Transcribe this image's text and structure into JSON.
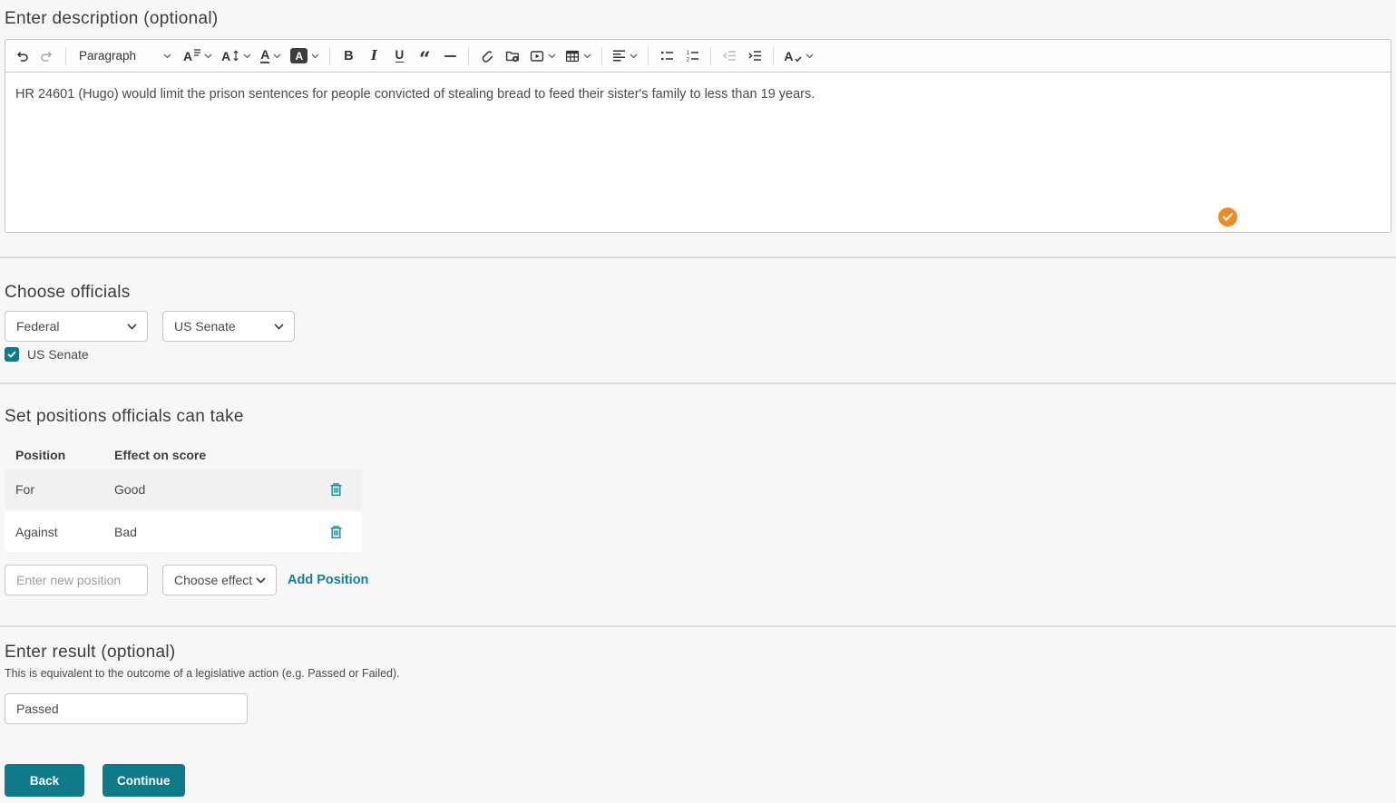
{
  "description_section": {
    "heading": "Enter description (optional)",
    "editor": {
      "block_format": "Paragraph",
      "content": "HR 24601 (Hugo) would limit the prison sentences for people convicted of stealing bread to feed their sister's family to less than 19 years.",
      "toolbar_buttons": [
        "undo",
        "redo",
        "paragraph-format",
        "font-family",
        "font-size",
        "font-color",
        "font-background-color",
        "bold",
        "italic",
        "underline",
        "block-quote",
        "horizontal-line",
        "link",
        "insert-file",
        "insert-media",
        "insert-table",
        "text-alignment",
        "bulleted-list",
        "numbered-list",
        "decrease-indent",
        "increase-indent",
        "text-style"
      ],
      "status_icon": "orange-check-badge"
    }
  },
  "officials_section": {
    "heading": "Choose officials",
    "jurisdiction_select_value": "Federal",
    "body_select_value": "US Senate",
    "checkbox": {
      "label": "US Senate",
      "checked": true
    }
  },
  "positions_section": {
    "heading": "Set positions officials can take",
    "table": {
      "headers": [
        "Position",
        "Effect on score"
      ],
      "rows": [
        {
          "position": "For",
          "effect": "Good"
        },
        {
          "position": "Against",
          "effect": "Bad"
        }
      ]
    },
    "new_position_placeholder": "Enter new position",
    "effect_select_value": "Choose effect",
    "add_position_label": "Add Position"
  },
  "result_section": {
    "heading": "Enter result (optional)",
    "helper_text": "This is equivalent to the outcome of a legislative action (e.g. Passed or Failed).",
    "input_value": "Passed"
  },
  "actions": {
    "back_label": "Back",
    "continue_label": "Continue"
  },
  "colors": {
    "accent_teal": "#0f7b8a",
    "accent_orange": "#ef8a20",
    "row_stripe": "#f1f1f1",
    "page_background": "#f7f7f8"
  }
}
